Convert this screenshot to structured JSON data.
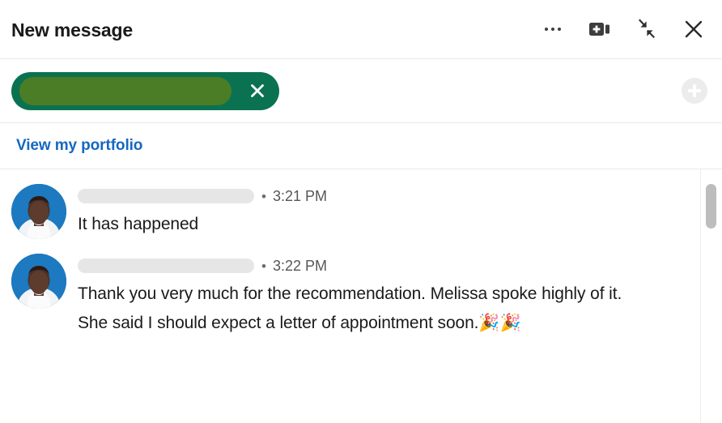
{
  "header": {
    "title": "New message",
    "actions": [
      {
        "name": "more-options",
        "icon": "ellipsis-icon",
        "label": "More options"
      },
      {
        "name": "video-message",
        "icon": "video-camera-plus-icon",
        "label": "Record a video message"
      },
      {
        "name": "collapse-window",
        "icon": "collapse-arrows-icon",
        "label": "Collapse"
      },
      {
        "name": "close-window",
        "icon": "close-x-icon",
        "label": "Close"
      }
    ]
  },
  "recipient": {
    "chip_label": "",
    "chip_redacted": true,
    "remove_label": "Remove recipient",
    "add_label": "Add recipient",
    "colors": {
      "chip_background": "#0a7250",
      "chip_redaction": "#4b7c26",
      "add_button_background": "#ececec"
    }
  },
  "portfolio": {
    "link_label": "View my portfolio",
    "link_color": "#1568bf"
  },
  "conversation": {
    "messages": [
      {
        "sender_name": "",
        "sender_redacted": true,
        "separator": "•",
        "timestamp": "3:21 PM",
        "text": "It has happened",
        "avatar_name": "sender-avatar"
      },
      {
        "sender_name": "",
        "sender_redacted": true,
        "separator": "•",
        "timestamp": "3:22 PM",
        "text": "Thank you very much for the recommendation. Melissa spoke highly of it. She said I should expect a letter of appointment soon.🎉🎉",
        "avatar_name": "sender-avatar"
      }
    ]
  },
  "scrollbar": {
    "orientation": "vertical",
    "thumb_position_percent": 6,
    "thumb_size_percent": 18
  }
}
